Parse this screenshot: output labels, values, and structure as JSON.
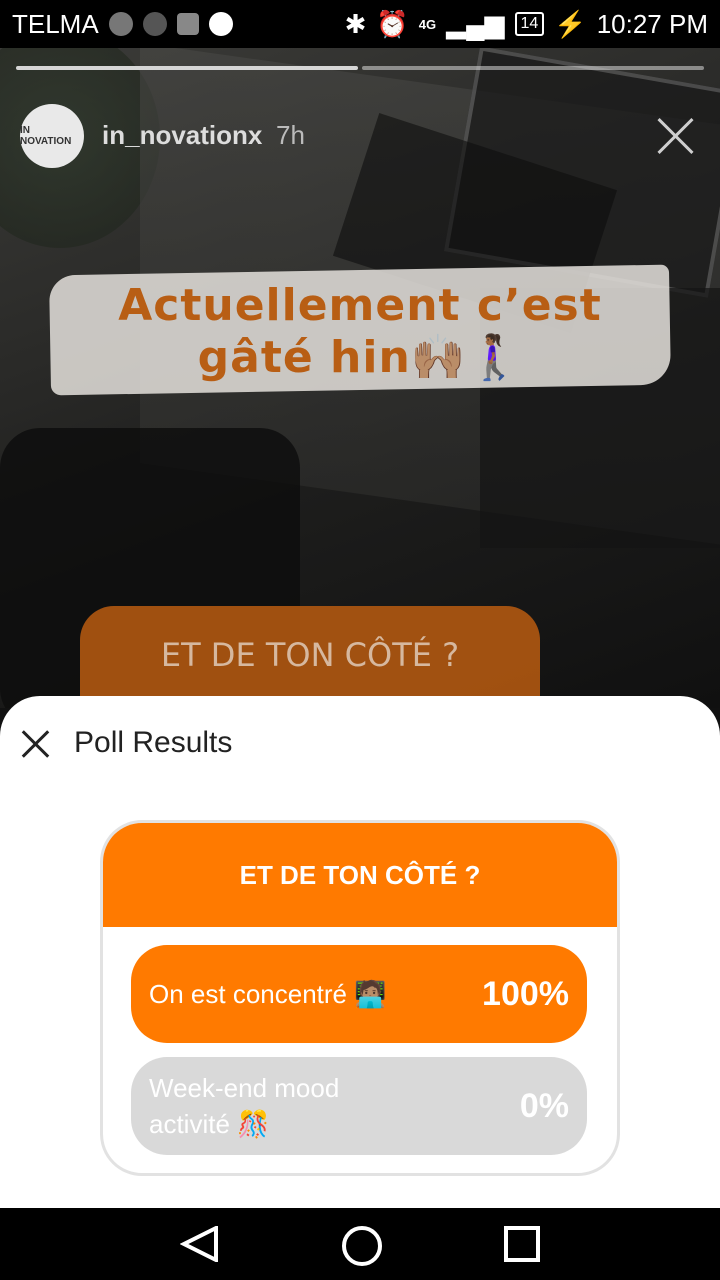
{
  "status_bar": {
    "carrier": "TELMA",
    "network": "4G",
    "battery": "14",
    "time": "10:27 PM"
  },
  "story": {
    "username": "in_novationx",
    "age": "7h",
    "avatar_text": "IN NOVATION",
    "sticker_text": "Actuellement c’est gâté hin🙌🏽🚶🏾‍♀️",
    "question_preview": "ET DE TON CÔTÉ ?"
  },
  "sheet": {
    "title": "Poll Results",
    "poll": {
      "question": "ET DE TON CÔTÉ ?",
      "options": [
        {
          "label": "On est concentré 🧑🏽‍💻",
          "percent": "100%"
        },
        {
          "label": "Week-end mood activité 🎊",
          "percent": "0%"
        }
      ]
    }
  },
  "colors": {
    "accent": "#ff7a00",
    "option_inactive": "#d9d9d9"
  }
}
